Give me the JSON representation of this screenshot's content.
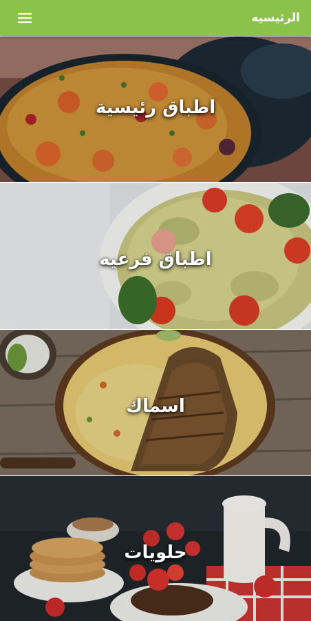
{
  "app_bar": {
    "title": "الرئيسيه",
    "menu_icon": "hamburger-menu-icon",
    "background": "#8bc34a"
  },
  "categories": [
    {
      "label": "اطباق رئيسية",
      "image": "paella-rice-pan-photo"
    },
    {
      "label": "اطباق فرعيه",
      "image": "pasta-salad-photo"
    },
    {
      "label": "اسماك",
      "image": "grilled-fish-rice-photo"
    },
    {
      "label": "حلويات",
      "image": "pancakes-strawberries-photo"
    }
  ]
}
